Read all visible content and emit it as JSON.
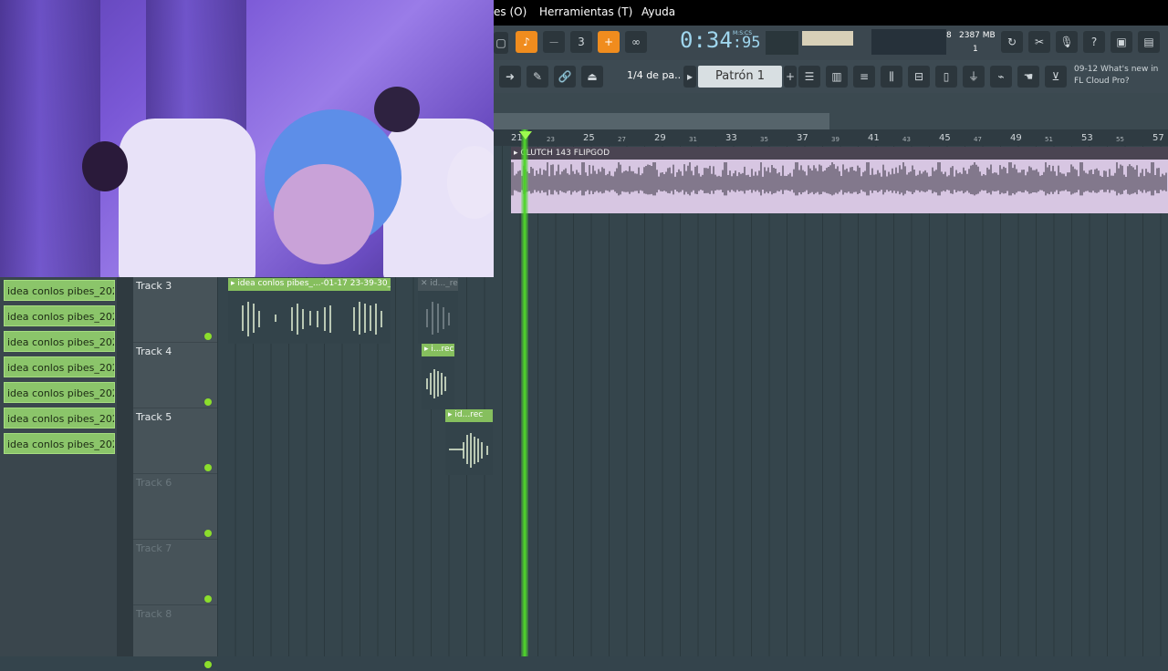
{
  "menu": {
    "items": [
      "es (O)",
      "Herramientas (T)",
      "Ayuda"
    ]
  },
  "transport": {
    "time": "0:34",
    "time_fraction": "95",
    "time_unit": "M:S:CS",
    "cpu": "8",
    "memory": "2387 MB",
    "polyphony": "1"
  },
  "toolbar2": {
    "snap": "1/4 de pa..",
    "pattern": "Patrón 1",
    "news_date": "09-12",
    "news_text": "What's new in FL Cloud Pro?"
  },
  "ruler": {
    "major": [
      "21",
      "25",
      "29",
      "33",
      "37",
      "41",
      "45",
      "49",
      "53",
      "57"
    ],
    "minor": [
      "23",
      "27",
      "31",
      "35",
      "39",
      "43",
      "47",
      "51",
      "55"
    ]
  },
  "clip_list": [
    "idea conlos pibes_2026-...",
    "idea conlos pibes_2026-...",
    "idea conlos pibes_2026-...",
    "idea conlos pibes_2026-...",
    "idea conlos pibes_2026-...",
    "idea conlos pibes_2026-...",
    "idea conlos pibes_2026-..."
  ],
  "tracks": [
    {
      "name": "Track 3"
    },
    {
      "name": "Track 4"
    },
    {
      "name": "Track 5"
    },
    {
      "name": "Track 6"
    },
    {
      "name": "Track 7"
    },
    {
      "name": "Track 8"
    }
  ],
  "clips": {
    "clutch_title": "CLUTCH 143 FLIPGOD",
    "track3_main": "idea conlos pibes_...-01-17 23-39-30_rec",
    "track3_ghost": "id..._rec",
    "track4": "i...rec",
    "track5": "id...rec"
  },
  "colors": {
    "accent": "#f08c1e",
    "clip_green": "#8bc56a",
    "playhead": "#4fd42c",
    "clutch_clip": "#d7c6e2"
  }
}
